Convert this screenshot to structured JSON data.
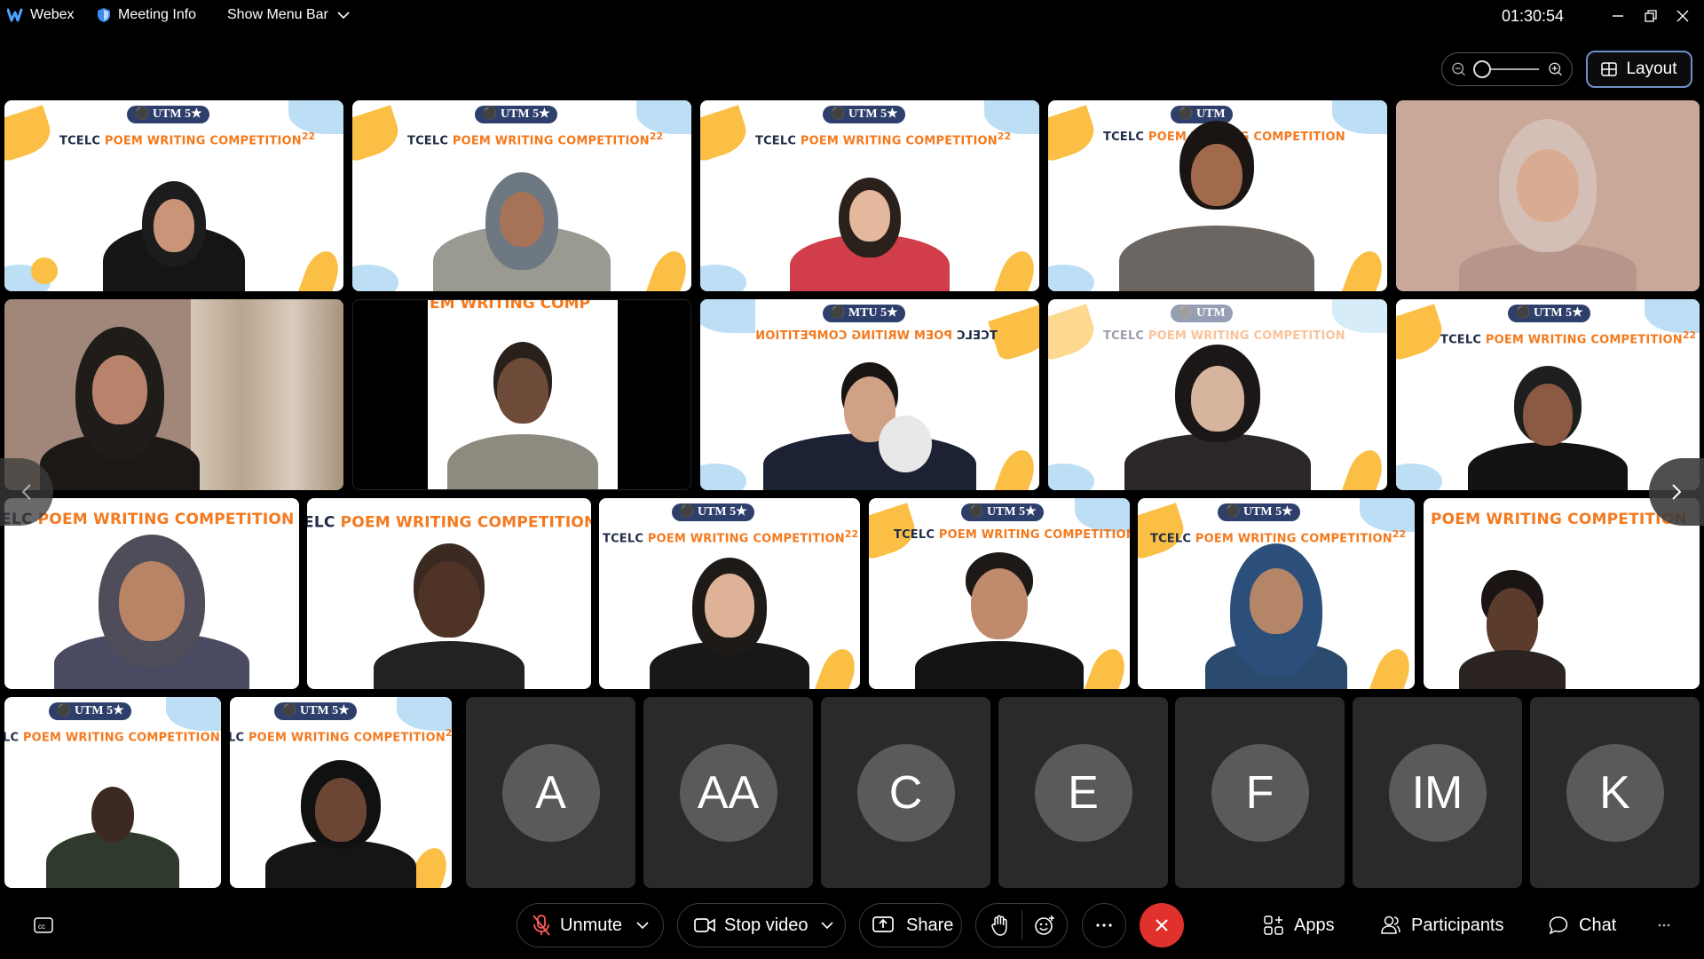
{
  "titlebar": {
    "app_name": "Webex",
    "meeting_info_label": "Meeting Info",
    "menu_bar_label": "Show Menu Bar",
    "timer": "01:30:54"
  },
  "view": {
    "layout_label": "Layout",
    "zoom_level": 0
  },
  "banner": {
    "university": "UTM",
    "title_dark": "TCELC ",
    "title_orange": "POEM WRITING COMPETITION",
    "title_sup": "22",
    "mirrored_university": "MTU"
  },
  "participants_avatars": [
    {
      "initials": "A"
    },
    {
      "initials": "AA"
    },
    {
      "initials": "C"
    },
    {
      "initials": "E"
    },
    {
      "initials": "F"
    },
    {
      "initials": "IM"
    },
    {
      "initials": "K"
    }
  ],
  "controls": {
    "unmute_label": "Unmute",
    "stop_video_label": "Stop video",
    "share_label": "Share",
    "apps_label": "Apps",
    "participants_label": "Participants",
    "chat_label": "Chat"
  },
  "colors": {
    "brand_orange": "#f47a1f",
    "brand_navy": "#1f2b46",
    "end_call": "#e0312c",
    "layout_border": "#6e90c7"
  },
  "icons": [
    "webex-logo-icon",
    "shield-icon",
    "chevron-down-icon",
    "minimize-icon",
    "restore-icon",
    "close-icon",
    "zoom-out-icon",
    "zoom-in-icon",
    "layout-grid-icon",
    "captions-icon",
    "mic-muted-icon",
    "video-camera-icon",
    "share-icon",
    "raise-hand-icon",
    "reactions-icon",
    "more-icon",
    "end-call-icon",
    "apps-icon",
    "participants-icon",
    "chat-icon"
  ]
}
